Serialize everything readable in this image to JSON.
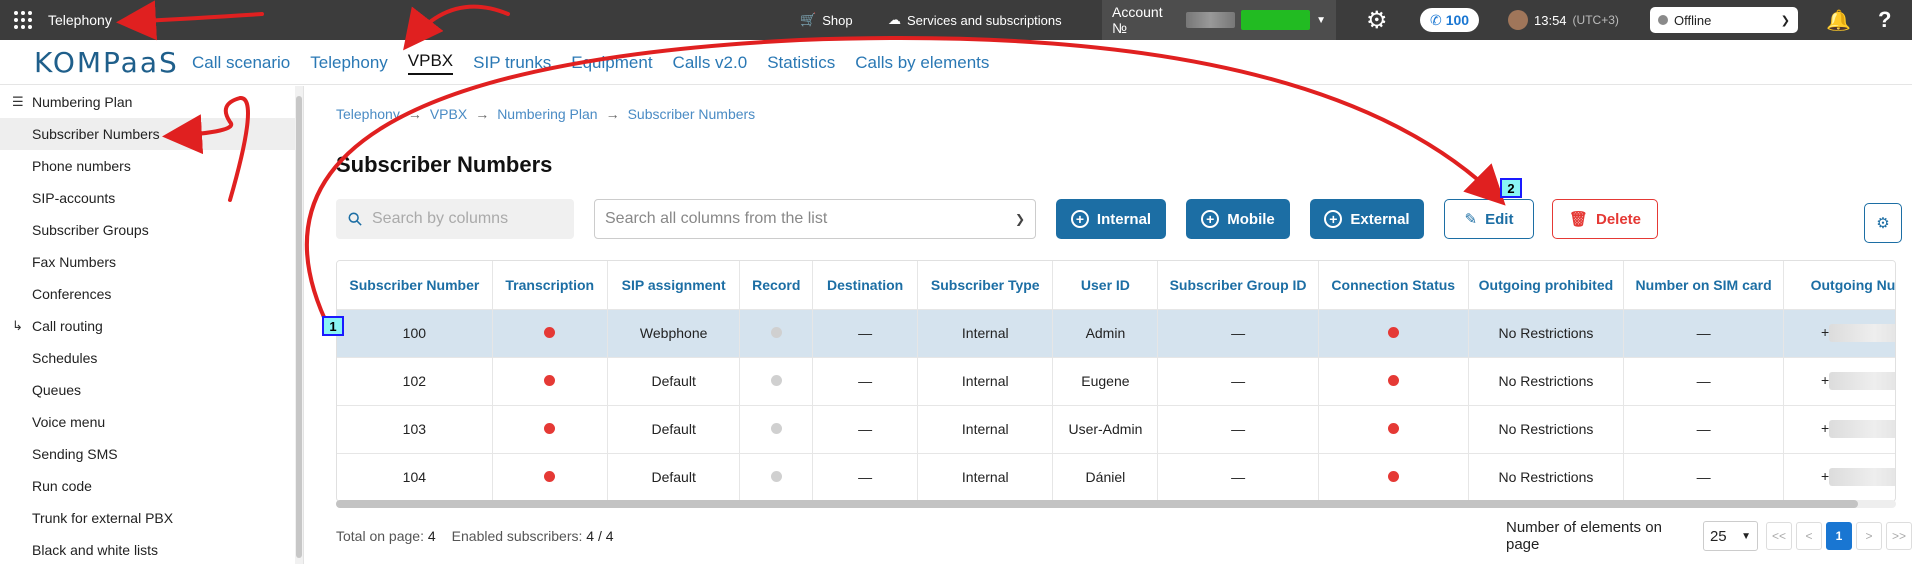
{
  "topbar": {
    "app_title": "Telephony",
    "shop": "Shop",
    "services": "Services and subscriptions",
    "account_label": "Account №",
    "calls_count": "100",
    "time": "13:54",
    "timezone": "(UTC+3)",
    "status": "Offline"
  },
  "nav": {
    "logo": "KOMPaaS",
    "tabs": [
      "Call scenario",
      "Telephony",
      "VPBX",
      "SIP trunks",
      "Equipment",
      "Calls v2.0",
      "Statistics",
      "Calls by elements"
    ],
    "active_tab": "VPBX"
  },
  "sidebar": {
    "numbering_plan": "Numbering Plan",
    "numbering_items": [
      "Subscriber Numbers",
      "Phone numbers",
      "SIP-accounts",
      "Subscriber Groups",
      "Fax Numbers",
      "Conferences"
    ],
    "call_routing": "Call routing",
    "routing_items": [
      "Schedules",
      "Queues",
      "Voice menu",
      "Sending SMS",
      "Run code",
      "Trunk for external PBX",
      "Black and white lists"
    ]
  },
  "breadcrumb": [
    "Telephony",
    "VPBX",
    "Numbering Plan",
    "Subscriber Numbers"
  ],
  "page_title": "Subscriber Numbers",
  "toolbar": {
    "search_placeholder": "Search by columns",
    "search_all_placeholder": "Search all columns from the list",
    "internal": "Internal",
    "mobile": "Mobile",
    "external": "External",
    "edit": "Edit",
    "delete": "Delete"
  },
  "table": {
    "columns": [
      "Subscriber Number",
      "Transcription",
      "SIP assignment",
      "Record",
      "Destination",
      "Subscriber Type",
      "User ID",
      "Subscriber Group ID",
      "Connection Status",
      "Outgoing prohibited",
      "Number on SIM card",
      "Outgoing Number"
    ],
    "rows": [
      {
        "number": "100",
        "sip": "Webphone",
        "destination": "—",
        "type": "Internal",
        "user": "Admin",
        "group": "—",
        "outgoing": "No Restrictions",
        "sim": "—",
        "out_number": "+"
      },
      {
        "number": "102",
        "sip": "Default",
        "destination": "—",
        "type": "Internal",
        "user": "Eugene",
        "group": "—",
        "outgoing": "No Restrictions",
        "sim": "—",
        "out_number": "+"
      },
      {
        "number": "103",
        "sip": "Default",
        "destination": "—",
        "type": "Internal",
        "user": "User-Admin",
        "group": "—",
        "outgoing": "No Restrictions",
        "sim": "—",
        "out_number": "+"
      },
      {
        "number": "104",
        "sip": "Default",
        "destination": "—",
        "type": "Internal",
        "user": "Dániel",
        "group": "—",
        "outgoing": "No Restrictions",
        "sim": "—",
        "out_number": "+"
      }
    ]
  },
  "footer": {
    "total_label": "Total on page:",
    "total": "4",
    "enabled_label": "Enabled subscribers:",
    "enabled": "4 / 4",
    "page_size_label": "Number of elements on page",
    "page_size": "25",
    "current_page": "1",
    "first": "<<",
    "prev": "<",
    "next": ">",
    "last": ">>"
  },
  "annotations": {
    "marker1": "1",
    "marker2": "2",
    "arrow_color": "#e02020"
  },
  "colors": {
    "accent": "#1c6ea4",
    "danger": "#e53935",
    "topbar": "#3c3c3c",
    "selected_row": "#d5e3ee"
  }
}
